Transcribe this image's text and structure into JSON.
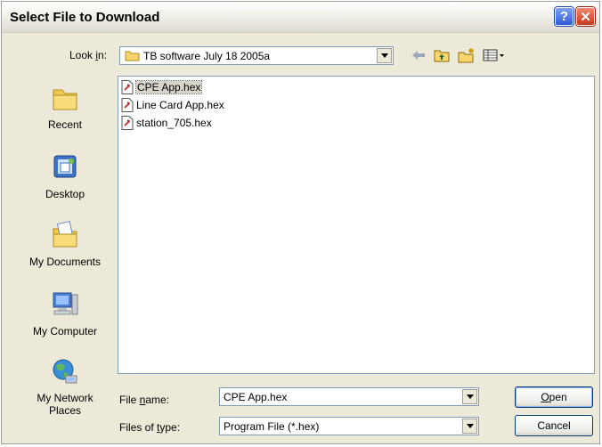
{
  "window": {
    "title": "Select File to Download",
    "help_glyph": "?",
    "close_glyph": "✕"
  },
  "lookin": {
    "label_pre": "Look ",
    "label_accel": "i",
    "label_post": "n:",
    "value": "TB software July 18 2005a"
  },
  "places": [
    {
      "label": "Recent",
      "icon": "recent-folder-icon"
    },
    {
      "label": "Desktop",
      "icon": "desktop-icon"
    },
    {
      "label": "My Documents",
      "icon": "my-documents-icon"
    },
    {
      "label": "My Computer",
      "icon": "my-computer-icon"
    },
    {
      "label_line1": "My Network",
      "label_line2": "Places",
      "icon": "network-places-icon"
    }
  ],
  "files": [
    {
      "name": "CPE App.hex",
      "selected": true
    },
    {
      "name": "Line Card App.hex",
      "selected": false
    },
    {
      "name": "station_705.hex",
      "selected": false
    }
  ],
  "filename": {
    "label_pre": "File ",
    "label_accel": "n",
    "label_post": "ame:",
    "value": "CPE App.hex"
  },
  "filetype": {
    "label_pre": "Files of ",
    "label_accel": "t",
    "label_post": "ype:",
    "value": "Program File (*.hex)"
  },
  "buttons": {
    "open_accel": "O",
    "open_rest": "pen",
    "cancel": "Cancel"
  }
}
